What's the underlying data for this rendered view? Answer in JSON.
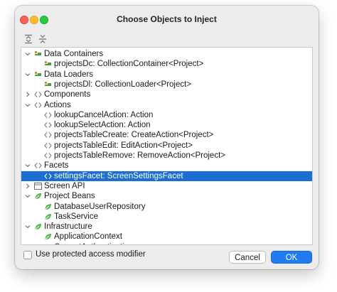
{
  "window": {
    "title": "Choose Objects to Inject"
  },
  "toolbar": {
    "expand_all_icon": "expand-all-icon",
    "collapse_all_icon": "collapse-all-icon"
  },
  "tree": {
    "rows": [
      {
        "label": "Data Containers",
        "arrow": "⌄",
        "icon": "data-icon",
        "level": 0
      },
      {
        "label": "projectsDc: CollectionContainer<Project>",
        "arrow": "",
        "icon": "data-icon",
        "level": 1
      },
      {
        "label": "Data Loaders",
        "arrow": "⌄",
        "icon": "data-icon",
        "level": 0
      },
      {
        "label": "projectsDl: CollectionLoader<Project>",
        "arrow": "",
        "icon": "data-icon",
        "level": 1
      },
      {
        "label": "Components",
        "arrow": "›",
        "icon": "code-brackets-icon",
        "level": 0
      },
      {
        "label": "Actions",
        "arrow": "⌄",
        "icon": "code-brackets-icon",
        "level": 0
      },
      {
        "label": "lookupCancelAction: Action",
        "arrow": "",
        "icon": "code-brackets-icon",
        "level": 1
      },
      {
        "label": "lookupSelectAction: Action",
        "arrow": "",
        "icon": "code-brackets-icon",
        "level": 1
      },
      {
        "label": "projectsTableCreate: CreateAction<Project>",
        "arrow": "",
        "icon": "code-brackets-icon",
        "level": 1
      },
      {
        "label": "projectsTableEdit: EditAction<Project>",
        "arrow": "",
        "icon": "code-brackets-icon",
        "level": 1
      },
      {
        "label": "projectsTableRemove: RemoveAction<Project>",
        "arrow": "",
        "icon": "code-brackets-icon",
        "level": 1
      },
      {
        "label": "Facets",
        "arrow": "⌄",
        "icon": "code-brackets-icon",
        "level": 0
      },
      {
        "label": "settingsFacet: ScreenSettingsFacet",
        "arrow": "",
        "icon": "code-brackets-icon",
        "level": 1,
        "selected": true
      },
      {
        "label": "Screen API",
        "arrow": "›",
        "icon": "window-icon",
        "level": 0
      },
      {
        "label": "Project Beans",
        "arrow": "⌄",
        "icon": "spring-leaf-icon",
        "level": 0
      },
      {
        "label": "DatabaseUserRepository",
        "arrow": "",
        "icon": "spring-leaf-icon",
        "level": 1
      },
      {
        "label": "TaskService",
        "arrow": "",
        "icon": "spring-leaf-icon",
        "level": 1
      },
      {
        "label": "Infrastructure",
        "arrow": "⌄",
        "icon": "spring-leaf-icon",
        "level": 0
      },
      {
        "label": "ApplicationContext",
        "arrow": "",
        "icon": "spring-leaf-icon",
        "level": 1
      },
      {
        "label": "CurrentAuthentication",
        "arrow": "",
        "icon": "spring-leaf-icon",
        "level": 1
      }
    ]
  },
  "footer": {
    "checkbox_label": "Use protected access modifier",
    "checkbox_checked": false,
    "cancel_label": "Cancel",
    "ok_label": "OK"
  },
  "colors": {
    "selection": "#1a6fd0",
    "primary_button": "#1f7cf2",
    "spring_green": "#5ab552",
    "data_icon_green": "#4f9a3b",
    "data_icon_orange": "#d78a2a",
    "bracket_gray": "#7d7d7d"
  }
}
